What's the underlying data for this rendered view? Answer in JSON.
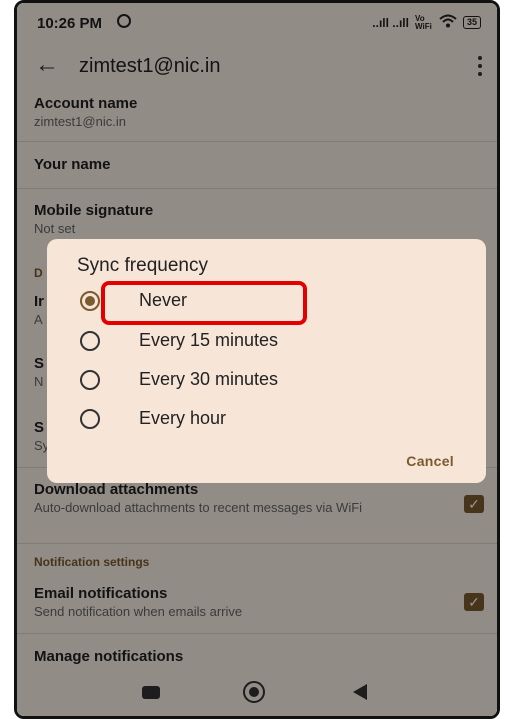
{
  "status_bar": {
    "time": "10:26 PM",
    "signal": "..ıll ..ıll",
    "vowifi": "Vo WiFi",
    "battery": "35"
  },
  "app_bar": {
    "title": "zimtest1@nic.in"
  },
  "settings": {
    "account_name": {
      "title": "Account name",
      "subtitle": "zimtest1@nic.in"
    },
    "your_name": {
      "title": "Your name"
    },
    "mobile_signature": {
      "title": "Mobile signature",
      "subtitle": "Not set"
    },
    "partial_section_header": "D",
    "partial_item_1": {
      "title": "Ir",
      "subtitle": "A"
    },
    "partial_item_2": {
      "title": "S",
      "subtitle": "N"
    },
    "partial_item_3": {
      "title": "S",
      "subtitle": "Sy"
    },
    "download_attachments": {
      "title": "Download attachments",
      "subtitle": "Auto-download attachments to recent messages via WiFi",
      "checked": true
    },
    "notification_section_header": "Notification settings",
    "email_notifications": {
      "title": "Email notifications",
      "subtitle": "Send notification when emails arrive",
      "checked": true
    },
    "manage_notifications": {
      "title": "Manage notifications"
    }
  },
  "dialog": {
    "title": "Sync frequency",
    "options": [
      {
        "label": "Never",
        "selected": true
      },
      {
        "label": "Every 15 minutes",
        "selected": false
      },
      {
        "label": "Every 30 minutes",
        "selected": false
      },
      {
        "label": "Every hour",
        "selected": false
      }
    ],
    "cancel_label": "Cancel"
  },
  "colors": {
    "accent": "#7a5a2e",
    "highlight_box": "#e40000",
    "background": "#fbf1e8",
    "dialog_background": "#f7e6d8"
  }
}
